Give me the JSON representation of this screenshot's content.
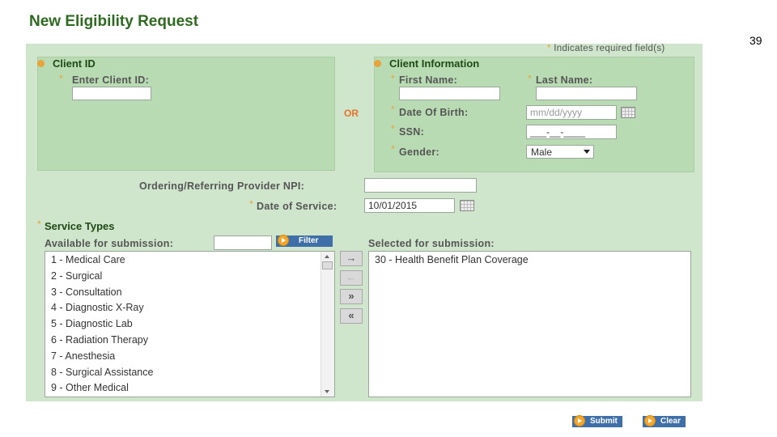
{
  "page": {
    "title": "New Eligibility Request",
    "slide_number": "39",
    "required_note": "Indicates required field(s)"
  },
  "client_id": {
    "heading": "Client ID",
    "enter_label": "Enter Client ID:",
    "value": ""
  },
  "or_label": "OR",
  "client_info": {
    "heading": "Client Information",
    "first_name_label": "First Name:",
    "last_name_label": "Last Name:",
    "dob_label": "Date Of Birth:",
    "dob_placeholder": "mm/dd/yyyy",
    "ssn_label": "SSN:",
    "ssn_mask": "___-__-____",
    "gender_label": "Gender:",
    "gender_value": "Male"
  },
  "provider": {
    "npi_label": "Ordering/Referring Provider NPI:",
    "npi_value": "",
    "dos_label": "Date of Service:",
    "dos_value": "10/01/2015"
  },
  "service_types": {
    "heading": "Service Types",
    "available_label": "Available for submission:",
    "filter_label": "Filter",
    "selected_label": "Selected for submission:",
    "available": [
      "1 - Medical Care",
      "2 - Surgical",
      "3 - Consultation",
      "4 - Diagnostic X-Ray",
      "5 - Diagnostic Lab",
      "6 - Radiation Therapy",
      "7 - Anesthesia",
      "8 - Surgical Assistance",
      "9 - Other Medical"
    ],
    "selected": [
      "30 - Health Benefit Plan Coverage"
    ],
    "move_buttons": [
      "→",
      "←",
      "»",
      "«"
    ]
  },
  "actions": {
    "submit_label": "Submit",
    "clear_label": "Clear"
  },
  "colors": {
    "panel": "#cfe5cc",
    "box": "#b9dbb3",
    "title": "#2e6b20",
    "required_star": "#e8a33a",
    "button": "#3e6fa8"
  }
}
